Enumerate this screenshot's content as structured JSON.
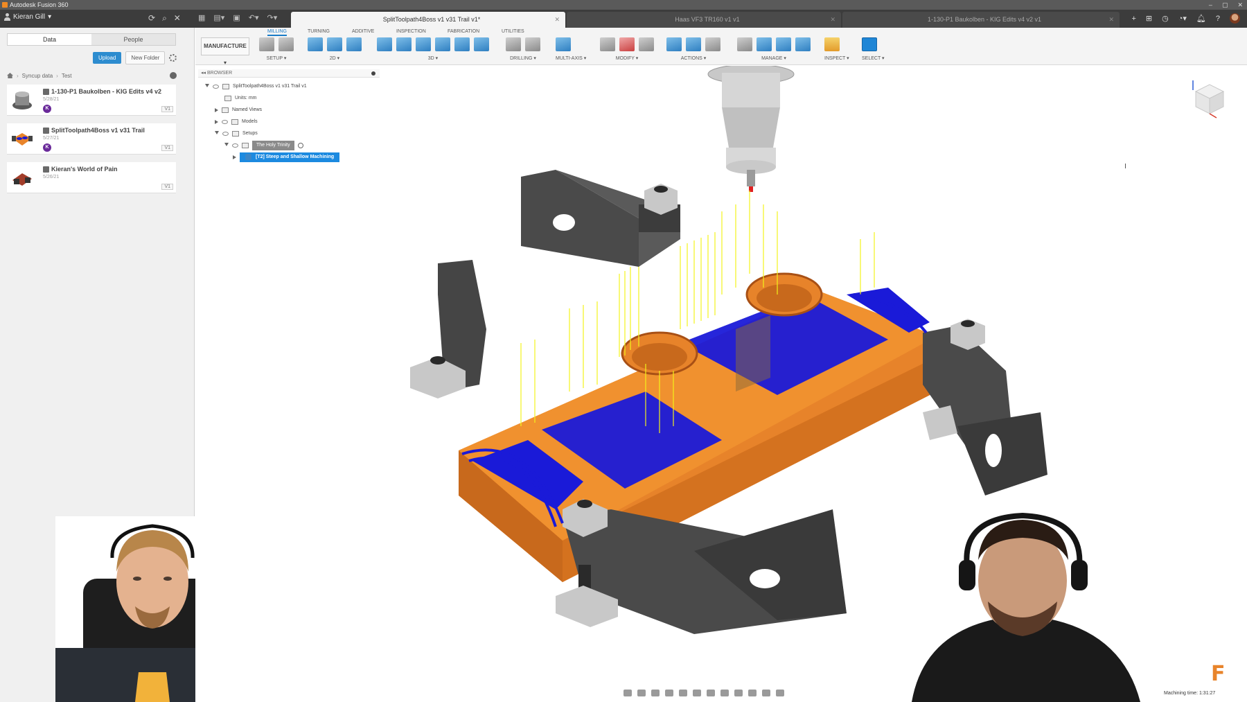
{
  "app": {
    "title": "Autodesk Fusion 360"
  },
  "account": {
    "user": "Kieran Gill"
  },
  "tabs": [
    {
      "label": "SplitToolpath4Boss v1 v31 Trail v1*"
    },
    {
      "label": "Haas VF3 TR160 v1 v1"
    },
    {
      "label": "1-130-P1 Baukolben - KIG Edits v4 v2 v1"
    }
  ],
  "data_panel": {
    "tab_data": "Data",
    "tab_people": "People",
    "upload": "Upload",
    "new_folder": "New Folder",
    "breadcrumb": [
      "Syncup data",
      "Test"
    ],
    "files": [
      {
        "title": "1-130-P1 Baukolben - KIG Edits v4 v2",
        "date": "5/28/21",
        "badge": "K",
        "version": "V1"
      },
      {
        "title": "SplitToolpath4Boss v1 v31 Trail",
        "date": "5/27/21",
        "badge": "K",
        "version": "V1"
      },
      {
        "title": "Kieran's World of Pain",
        "date": "5/26/21",
        "version": "V1"
      }
    ]
  },
  "toolbar": {
    "workspace": "MANUFACTURE",
    "ribbon_tabs": [
      "MILLING",
      "TURNING",
      "ADDITIVE",
      "INSPECTION",
      "FABRICATION",
      "UTILITIES"
    ],
    "groups": [
      "SETUP",
      "2D",
      "3D",
      "DRILLING",
      "MULTI-AXIS",
      "MODIFY",
      "ACTIONS",
      "MANAGE",
      "INSPECT",
      "SELECT"
    ]
  },
  "browser": {
    "header": "BROWSER",
    "root": "SplitToolpath4Boss v1 v31 Trail v1",
    "units": "Units: mm",
    "named_views": "Named Views",
    "models": "Models",
    "setups": "Setups",
    "setup_name": "The Holy Trinity",
    "operation": "[T2] Steep and Shallow Machining"
  },
  "status": {
    "machining_time": "Machining time: 1:31:27"
  },
  "colors": {
    "accent": "#1c8ae0",
    "stock": "#e8842b",
    "toolpath_blue": "#1a1ad8",
    "toolpath_yellow": "#f2f21a"
  },
  "icons": [
    "search-icon",
    "refresh-icon",
    "close-icon",
    "gear-icon",
    "home-icon",
    "eye-icon",
    "help-icon",
    "bell-icon"
  ]
}
